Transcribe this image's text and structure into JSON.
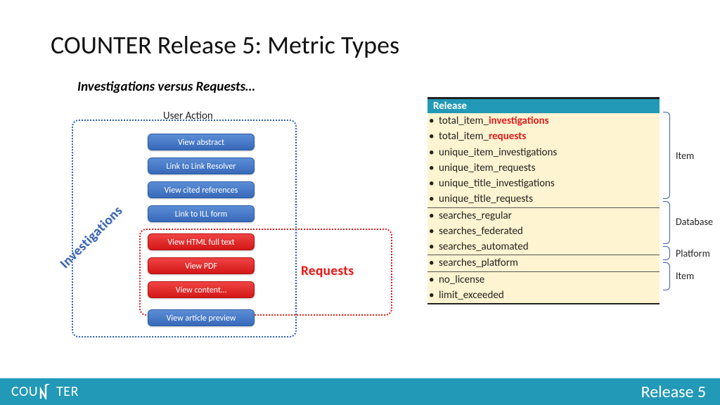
{
  "title": "COUNTER Release 5: Metric Types",
  "subtitle": "Investigations versus Requests…",
  "user_action_label": "User Action",
  "investigations_label": "Investigations",
  "requests_label": "Requests",
  "actions": {
    "a0": "View abstract",
    "a1": "Link to Link Resolver",
    "a2": "View cited references",
    "a3": "Link to ILL form",
    "a4": "View HTML full text",
    "a5": "View PDF",
    "a6": "View content…",
    "a7": "View article preview"
  },
  "release": {
    "header": "Release",
    "rows": {
      "r0_pre": "total_item_",
      "r0_em": "investigations",
      "r1_pre": "total_item_",
      "r1_em": "requests",
      "r2": "unique_item_investigations",
      "r3": "unique_item_requests",
      "r4": "unique_title_investigations",
      "r5": "unique_title_requests",
      "r6": "searches_regular",
      "r7": "searches_federated",
      "r8": "searches_automated",
      "r9": "searches_platform",
      "r10": "no_license",
      "r11": "limit_exceeded"
    }
  },
  "brackets": {
    "b0": "Item",
    "b1": "Database",
    "b2": "Platform",
    "b3": "Item"
  },
  "footer": {
    "logo_cou": "COU",
    "logo_ter": "TER",
    "right": "Release 5"
  }
}
